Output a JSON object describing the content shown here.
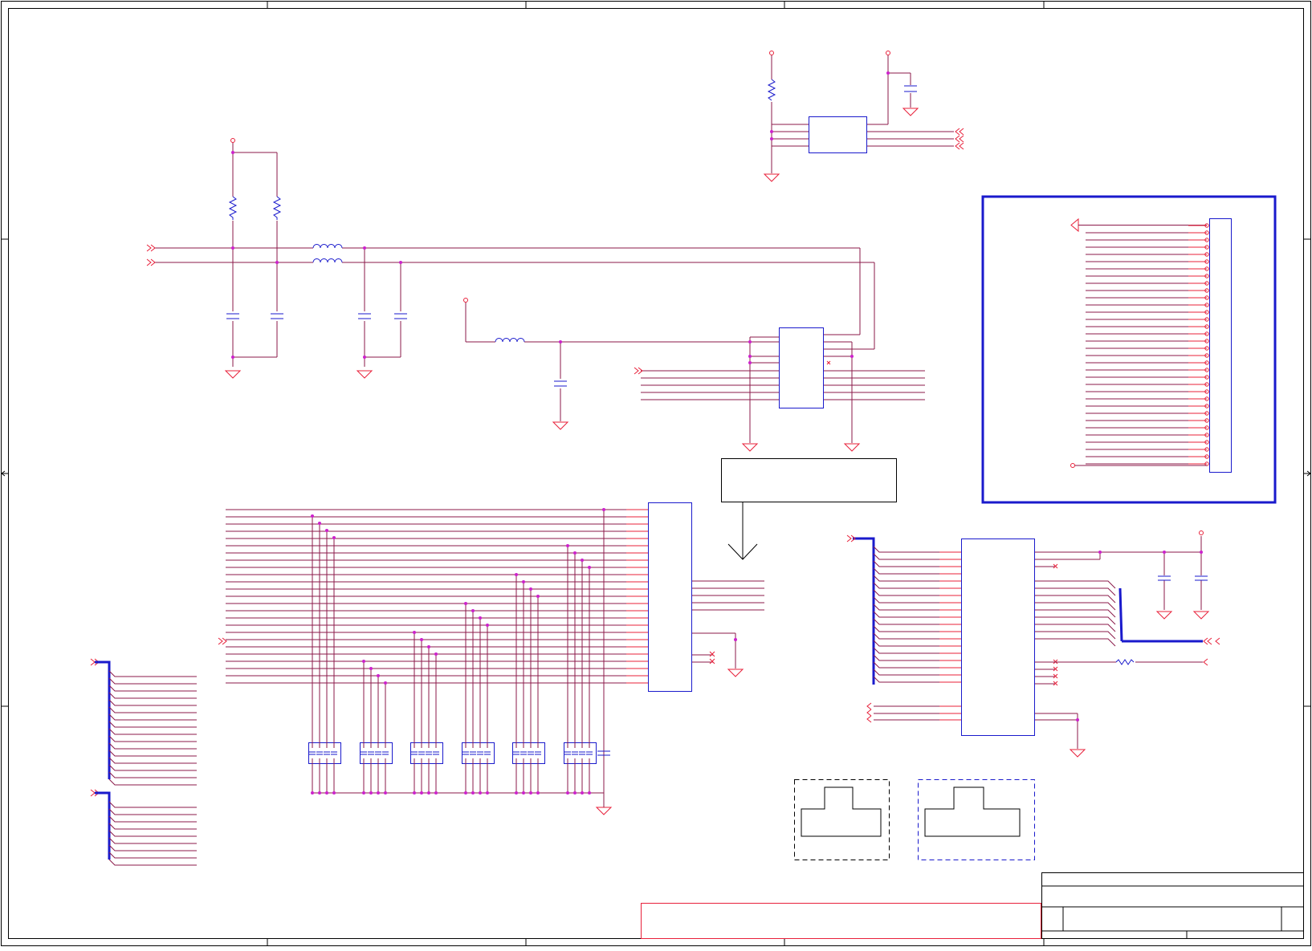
{
  "viewer": {
    "title": "",
    "kind": "schematic-sheet"
  },
  "colors": {
    "wire": "#8b1a4a",
    "pin": "#e8203a",
    "part_outline": "#1a1acc",
    "frame": "#000000",
    "note_box": "#e8203a",
    "junction": "#cc22cc",
    "dashed_black": "#000000",
    "dashed_blue": "#1a1acc"
  },
  "sheet": {
    "border_ticks": [
      "top",
      "bottom",
      "left",
      "right"
    ],
    "title_block_present": true
  },
  "schematic": {
    "labels_visible": false,
    "component_groups": [
      {
        "name": "power-regulator-circuit",
        "symbols": [
          "resistor-icon",
          "capacitor-icon",
          "ground-icon",
          "ic-icon"
        ]
      },
      {
        "name": "input-filter-circuit",
        "symbols": [
          "resistor-icon",
          "inductor-icon",
          "capacitor-icon",
          "ground-icon"
        ]
      },
      {
        "name": "lc-filter-circuit",
        "symbols": [
          "inductor-icon",
          "capacitor-icon",
          "ground-icon"
        ]
      },
      {
        "name": "control-ic-circuit",
        "symbols": [
          "ic-icon",
          "ground-icon"
        ]
      },
      {
        "name": "connector-module",
        "symbols": [
          "connector-icon",
          "ground-icon"
        ]
      },
      {
        "name": "main-connector-circuit",
        "symbols": [
          "ic-icon",
          "capacitor-array-icon",
          "ground-icon"
        ]
      },
      {
        "name": "bus-interface-circuit",
        "symbols": [
          "ic-icon",
          "resistor-icon",
          "capacitor-icon",
          "ground-icon"
        ]
      },
      {
        "name": "footprint-outlines",
        "symbols": [
          "footprint-icon"
        ]
      }
    ]
  }
}
